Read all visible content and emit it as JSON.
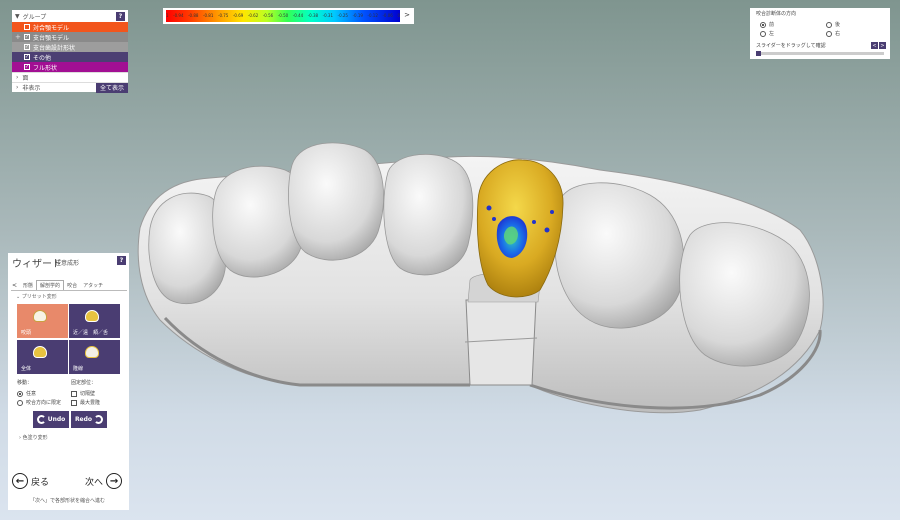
{
  "groups": {
    "title": "グループ",
    "help": "?",
    "items": [
      {
        "label": "対合顎モデル",
        "color": "#f2551c",
        "checked": false,
        "expander": ""
      },
      {
        "label": "支台顎モデル",
        "color": "#8a8a8a",
        "checked": true,
        "expander": "+"
      },
      {
        "label": "支台歯設計形状",
        "color": "#9d9d9d",
        "checked": true,
        "expander": ""
      },
      {
        "label": "その他",
        "color": "#4c3f73",
        "checked": true,
        "expander": ""
      },
      {
        "label": "フル形状",
        "color": "#a20f93",
        "checked": true,
        "expander": ""
      }
    ],
    "row_a": "面",
    "row_b": "非表示",
    "show_all": "全て表示"
  },
  "scale": {
    "ticks": [
      "1",
      "-0.94",
      "-0.88",
      "-0.81",
      "-0.75",
      "-0.69",
      "-0.62",
      "-0.56",
      "-0.50",
      "-0.44",
      "-0.38",
      "-0.31",
      "-0.25",
      "-0.19",
      "-0.12",
      "-0.06",
      "0"
    ],
    "arrow": ">"
  },
  "movement": {
    "title": "咬合診断体の方向",
    "options": [
      "前",
      "後",
      "左",
      "右"
    ],
    "selected": "前",
    "note": "スライダーをドラッグして確認",
    "prev": "<",
    "next": ">"
  },
  "wizard": {
    "title": "ウィザード",
    "subtitle": "任意成形",
    "help": "?",
    "tab_arrow": "<",
    "tabs": [
      "形態",
      "解剖学的",
      "咬合",
      "アタッチ"
    ],
    "active_tab": "解剖学的",
    "preset": "プリセット変形",
    "tiles": [
      "咬頭",
      "近／遠　頬／舌",
      "全体",
      "隆線"
    ],
    "move_label": "移動：",
    "fix_label": "固定部位：",
    "move_options": [
      "任意",
      "咬合方向に限定"
    ],
    "move_selected": "任意",
    "fix_options": [
      "切隔壁",
      "最大豊隆"
    ],
    "undo": "Undo",
    "redo": "Redo",
    "coloring": "色塗り変形",
    "back": "戻る",
    "next": "次へ",
    "note": "「次へ」で各部形状を縮合へ進む"
  }
}
